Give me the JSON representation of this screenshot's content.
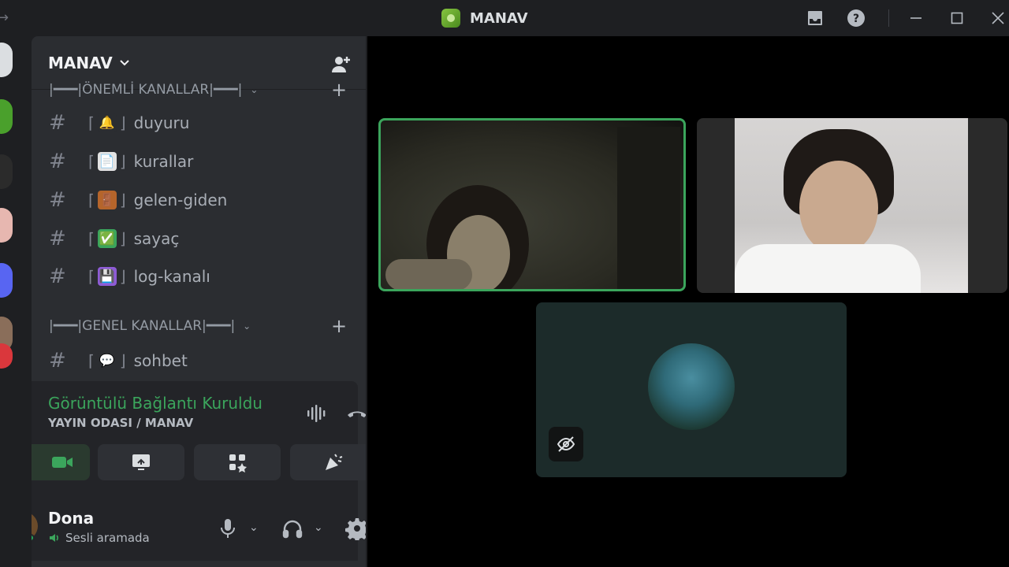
{
  "window": {
    "title": "MANAV"
  },
  "server": {
    "name": "MANAV"
  },
  "categories": [
    {
      "label": "|━━━|ÖNEMLİ KANALLAR|━━━|"
    },
    {
      "label": "|━━━|GENEL KANALLAR|━━━|"
    }
  ],
  "channels": [
    {
      "name": "duyuru",
      "emoji": "🔔",
      "emoji_bg": "#3a3220"
    },
    {
      "name": "kurallar",
      "emoji": "📄",
      "emoji_bg": "#d9d9d9"
    },
    {
      "name": "gelen-giden",
      "emoji": "🚪",
      "emoji_bg": "#b5652b"
    },
    {
      "name": "sayaç",
      "emoji": "✅",
      "emoji_bg": "#3ba55c"
    },
    {
      "name": "log-kanalı",
      "emoji": "💾",
      "emoji_bg": "#8e5bd6"
    },
    {
      "name": "sohbet",
      "emoji": "💬",
      "emoji_bg": "#2b2d31"
    }
  ],
  "voice": {
    "status": "Görüntülü Bağlantı Kuruldu",
    "location": "YAYIN ODASI / MANAV"
  },
  "user": {
    "name": "Dona",
    "status": "Sesli aramada"
  },
  "colors": {
    "accent_green": "#3ba55c",
    "sidebar_bg": "#2b2d31",
    "panel_bg": "#232428",
    "app_bg": "#1e1f22"
  },
  "icons": {
    "inbox": "inbox-icon",
    "help": "help-icon",
    "minimize": "minimize-icon",
    "maximize": "maximize-icon",
    "close": "close-icon"
  }
}
